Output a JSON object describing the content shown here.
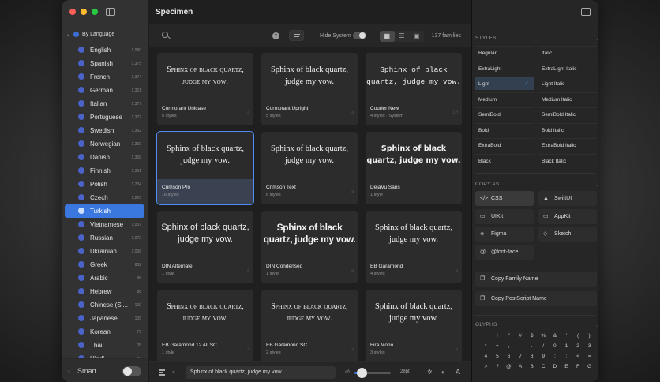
{
  "window": {
    "title": "Specimen"
  },
  "colors": {
    "accent": "#3a78e0",
    "selected_card_outline": "#4f8ef7",
    "close": "#ff5f57",
    "minimize": "#febc2e",
    "zoom": "#28c840"
  },
  "sidebar": {
    "group_label": "By Language",
    "languages": [
      {
        "label": "English",
        "count": "1,980"
      },
      {
        "label": "Spanish",
        "count": "1,375"
      },
      {
        "label": "French",
        "count": "1,374"
      },
      {
        "label": "German",
        "count": "1,361"
      },
      {
        "label": "Italian",
        "count": "1,377"
      },
      {
        "label": "Portuguese",
        "count": "1,372"
      },
      {
        "label": "Swedish",
        "count": "1,362"
      },
      {
        "label": "Norwegian",
        "count": "1,369"
      },
      {
        "label": "Danish",
        "count": "1,368"
      },
      {
        "label": "Finnish",
        "count": "1,361"
      },
      {
        "label": "Polish",
        "count": "1,234"
      },
      {
        "label": "Czech",
        "count": "1,226"
      },
      {
        "label": "Turkish",
        "count": ""
      },
      {
        "label": "Vietnamese",
        "count": "1,057"
      },
      {
        "label": "Russian",
        "count": "1,072"
      },
      {
        "label": "Ukrainian",
        "count": "1,036"
      },
      {
        "label": "Greek",
        "count": "862"
      },
      {
        "label": "Arabic",
        "count": "98"
      },
      {
        "label": "Hebrew",
        "count": "88"
      },
      {
        "label": "Chinese (Si...",
        "count": "100"
      },
      {
        "label": "Japanese",
        "count": "105"
      },
      {
        "label": "Korean",
        "count": "77"
      },
      {
        "label": "Thai",
        "count": "28"
      },
      {
        "label": "Hindi",
        "count": "34"
      }
    ],
    "selected_language": "Turkish",
    "footer_label": "Smart"
  },
  "toolbar": {
    "hide_system_label": "Hide System",
    "family_count": "137 families"
  },
  "sample_text": "Sphinx of black quartz, judge my vow.",
  "cards": [
    {
      "sample": "Sphinx of black quartz, judge my vow.",
      "name": "Cormorant Unicase",
      "styles": "5 styles",
      "corner": "a"
    },
    {
      "sample": "Sphinx of black quartz, judge my vow.",
      "name": "Cormorant Upright",
      "styles": "5 styles",
      "corner": "a"
    },
    {
      "sample": "Sphinx of black quartz, judge my vow.",
      "name": "Courier New",
      "styles": "4 styles · System",
      "corner": "LH"
    },
    {
      "sample": "Sphinx of black quartz, judge my vow.",
      "name": "Crimson Pro",
      "styles": "16 styles",
      "corner": "a"
    },
    {
      "sample": "Sphinx of black quartz, judge my vow.",
      "name": "Crimson Text",
      "styles": "6 styles",
      "corner": "a"
    },
    {
      "sample": "Sphinx of black quartz, judge my vow.",
      "name": "DejaVu Sans",
      "styles": "1 style",
      "corner": ""
    },
    {
      "sample": "Sphinx of black quartz, judge my vow.",
      "name": "DIN Alternate",
      "styles": "1 style",
      "corner": "a"
    },
    {
      "sample": "Sphinx of black quartz, judge my vow.",
      "name": "DIN Condensed",
      "styles": "1 style",
      "corner": "a"
    },
    {
      "sample": "Sphinx of black quartz, judge my vow.",
      "name": "EB Garamond",
      "styles": "4 styles",
      "corner": "a"
    },
    {
      "sample": "Sphinx of black quartz, judge my vow.",
      "name": "EB Garamond 12 All SC",
      "styles": "1 style",
      "corner": "a"
    },
    {
      "sample": "Sphinx of black quartz, judge my vow.",
      "name": "EB Garamond SC",
      "styles": "2 styles",
      "corner": "a"
    },
    {
      "sample": "Sphinx of black quartz, judge my vow.",
      "name": "Fira Mono",
      "styles": "3 styles",
      "corner": "a"
    }
  ],
  "bottom_bar": {
    "preview_text": "Sphinx of black quartz, judge my vow.",
    "size_label": "28pt",
    "size_small": "aA",
    "size_value": 0.2
  },
  "inspector": {
    "styles_title": "STYLES",
    "styles": [
      {
        "label": "Regular"
      },
      {
        "label": "Italic"
      },
      {
        "label": "ExtraLight"
      },
      {
        "label": "ExtraLight Italic"
      },
      {
        "label": "Light"
      },
      {
        "label": "Light Italic"
      },
      {
        "label": "Medium"
      },
      {
        "label": "Medium Italic"
      },
      {
        "label": "SemiBold"
      },
      {
        "label": "SemiBold Italic"
      },
      {
        "label": "Bold"
      },
      {
        "label": "Bold Italic"
      },
      {
        "label": "ExtraBold"
      },
      {
        "label": "ExtraBold Italic"
      },
      {
        "label": "Black"
      },
      {
        "label": "Black Italic"
      }
    ],
    "selected_style": "Light",
    "copy_as_title": "COPY AS",
    "copy_as": [
      {
        "label": "CSS",
        "icon": "</>"
      },
      {
        "label": "SwiftUI",
        "icon": "▲"
      },
      {
        "label": "UIKit",
        "icon": "▭"
      },
      {
        "label": "AppKit",
        "icon": "▭"
      },
      {
        "label": "Figma",
        "icon": "◈"
      },
      {
        "label": "Sketch",
        "icon": "◇"
      },
      {
        "label": "@font-face",
        "icon": "@"
      }
    ],
    "copy_family": "Copy Family Name",
    "copy_postscript": "Copy PostScript Name",
    "glyphs_title": "GLYPHS",
    "glyph_rows": [
      [
        " ",
        "!",
        "\"",
        "#",
        "$",
        "%",
        "&",
        "'",
        "(",
        ")"
      ],
      [
        "*",
        "+",
        ",",
        "-",
        ".",
        "/",
        "0",
        "1",
        "2",
        "3"
      ],
      [
        "4",
        "5",
        "6",
        "7",
        "8",
        "9",
        ":",
        ";",
        "<",
        "="
      ],
      [
        ">",
        "?",
        "@",
        "A",
        "B",
        "C",
        "D",
        "E",
        "F",
        "G"
      ]
    ]
  }
}
